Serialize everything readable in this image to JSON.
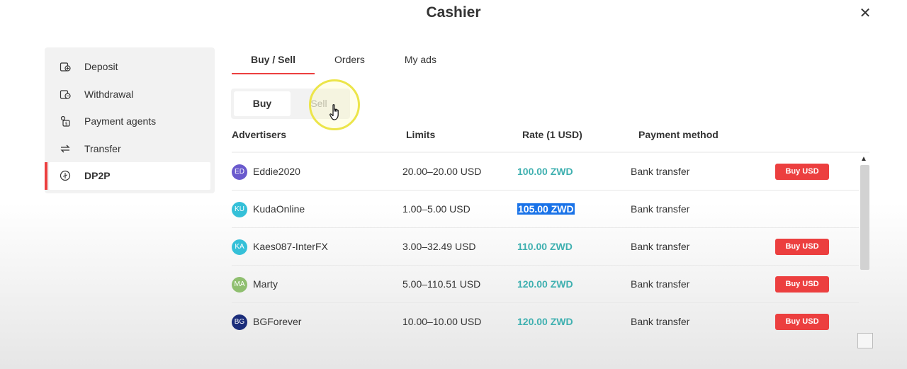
{
  "modal": {
    "title": "Cashier",
    "close_glyph": "✕"
  },
  "sidebar": {
    "items": [
      {
        "label": "Deposit",
        "icon": "deposit-icon"
      },
      {
        "label": "Withdrawal",
        "icon": "withdrawal-icon"
      },
      {
        "label": "Payment agents",
        "icon": "payment-agents-icon"
      },
      {
        "label": "Transfer",
        "icon": "transfer-icon"
      },
      {
        "label": "DP2P",
        "icon": "dp2p-icon",
        "active": true
      }
    ]
  },
  "tabs": [
    {
      "label": "Buy / Sell",
      "active": true
    },
    {
      "label": "Orders"
    },
    {
      "label": "My ads"
    }
  ],
  "toggle": {
    "buy": "Buy",
    "sell": "Sell",
    "selected": "Buy"
  },
  "table": {
    "headers": {
      "advertisers": "Advertisers",
      "limits": "Limits",
      "rate": "Rate (1 USD)",
      "payment": "Payment method"
    },
    "rows": [
      {
        "initials": "ED",
        "name": "Eddie2020",
        "limits": "20.00–20.00 USD",
        "rate": "100.00 ZWD",
        "payment": "Bank transfer",
        "action": "Buy USD",
        "avatar_color": "#6a5acd"
      },
      {
        "initials": "KU",
        "name": "KudaOnline",
        "limits": "1.00–5.00 USD",
        "rate": "105.00 ZWD",
        "payment": "Bank transfer",
        "action": "",
        "avatar_color": "#35c0d8",
        "rate_selected": true
      },
      {
        "initials": "KA",
        "name": "Kaes087-InterFX",
        "limits": "3.00–32.49 USD",
        "rate": "110.00 ZWD",
        "payment": "Bank transfer",
        "action": "Buy USD",
        "avatar_color": "#35c0d8"
      },
      {
        "initials": "MA",
        "name": "Marty",
        "limits": "5.00–110.51 USD",
        "rate": "120.00 ZWD",
        "payment": "Bank transfer",
        "action": "Buy USD",
        "avatar_color": "#8fbf6f"
      },
      {
        "initials": "BG",
        "name": "BGForever",
        "limits": "10.00–10.00 USD",
        "rate": "120.00 ZWD",
        "payment": "Bank transfer",
        "action": "Buy USD",
        "avatar_color": "#1a2c7a"
      }
    ]
  },
  "colors": {
    "accent": "#ec3f3f",
    "rate": "#3fb0b0",
    "selection": "#1a73e8"
  }
}
